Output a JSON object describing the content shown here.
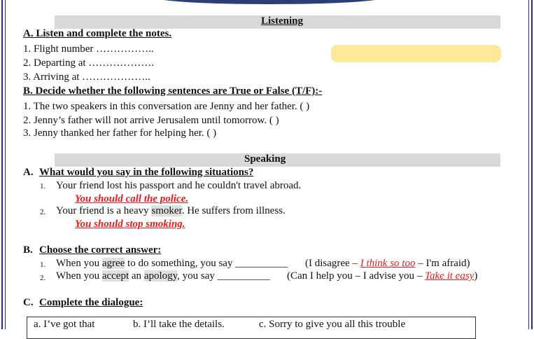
{
  "listening": {
    "title": "Listening",
    "a_heading": "A. Listen and complete the notes.",
    "notes": [
      "1. Flight number ……………..",
      "2. Departing at ……………….",
      "3. Arriving at ……………….."
    ],
    "b_heading": "B. Decide whether the following sentences are True or False (T/F):-",
    "tf": [
      "1. The two speakers in this conversation are Jenny and her father. (     )",
      "2. Jenny’s father will not arrive Jerusalem until tomorrow. (     )",
      "3. Jenny thanked her father for helping her. (    )"
    ]
  },
  "speaking": {
    "title": "Speaking",
    "a_label": "A.",
    "a_heading": "What would you say in the following situations?",
    "situations": [
      {
        "num": "1.",
        "text": "Your friend lost his passport and he couldn't travel abroad.",
        "answer": "You  should  call the police."
      },
      {
        "num": "2.",
        "text_before": "Your friend is a heavy ",
        "text_hl": "smoker",
        "text_after": ". He suffers from illness.",
        "answer": "You should stop smoking."
      }
    ],
    "b_label": "B.",
    "b_heading": "Choose the correct answer:",
    "choices": [
      {
        "num": "1.",
        "pre": "When you ",
        "hl": "agree",
        "post": " to do something, you say __________",
        "opt_pre": "(I disagree – ",
        "opt_ans": "I think so too",
        "opt_post": " – I'm afraid)"
      },
      {
        "num": "2.",
        "pre": "When you ",
        "hl": "accept",
        "mid": " an ",
        "hl2": "apology",
        "post": ", you say __________",
        "opt_pre": "(Can I help you – I advise you – ",
        "opt_ans": "Take it easy",
        "opt_post": ")"
      }
    ],
    "c_label": "C.",
    "c_heading": "Complete the dialogue:",
    "dialogue_options": [
      "a. I’ve got that",
      "b. I’ll take the details.",
      "c. Sorry to give you all this trouble"
    ]
  },
  "colors": {
    "frame": "#1c2f8f",
    "answer": "#e31b1b",
    "highlight": "#fde79a",
    "band": "#d9d9d9"
  }
}
